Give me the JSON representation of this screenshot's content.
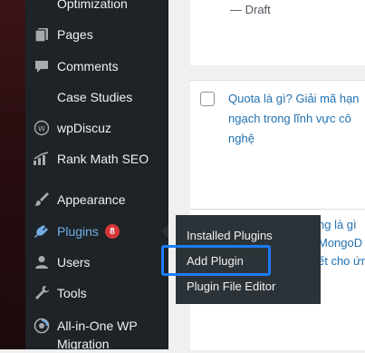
{
  "sidebar": {
    "items": [
      {
        "label": "Optimization",
        "icon": "none"
      },
      {
        "label": "Pages",
        "icon": "pages-icon"
      },
      {
        "label": "Comments",
        "icon": "comments-icon"
      },
      {
        "label": "Case Studies",
        "icon": "none"
      },
      {
        "label": "wpDiscuz",
        "icon": "wpdiscuz-icon"
      },
      {
        "label": "Rank Math SEO",
        "icon": "rank-math-icon"
      },
      {
        "label": "Appearance",
        "icon": "appearance-icon"
      },
      {
        "label": "Plugins",
        "icon": "plugins-icon",
        "badge": "8",
        "active": true
      },
      {
        "label": "Users",
        "icon": "users-icon"
      },
      {
        "label": "Tools",
        "icon": "tools-icon"
      },
      {
        "label_line1": "All-in-One WP",
        "label_line2": "Migration",
        "icon": "migration-icon"
      }
    ]
  },
  "flyout": {
    "items": [
      "Installed Plugins",
      "Add Plugin",
      "Plugin File Editor"
    ]
  },
  "content": {
    "draft_text": "— Draft",
    "post1_lines": [
      "Quota là gì? Giải mã hạn",
      "ngạch trong lĩnh vực cô",
      "nghệ"
    ],
    "post2_lines": [
      "ng là gì",
      "MongoD",
      "ết cho ứn"
    ]
  },
  "colors": {
    "sidebar_bg": "#1d2327",
    "flyout_bg": "#2c3338",
    "accent": "#72aee6",
    "badge": "#d63638",
    "link": "#2271b1",
    "highlight_border": "#1c7cf5"
  }
}
